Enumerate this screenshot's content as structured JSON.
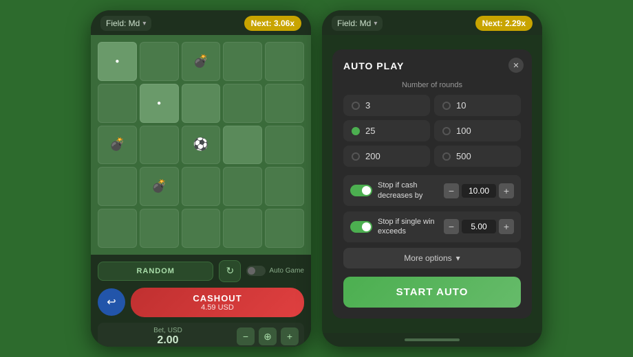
{
  "left_phone": {
    "field_label": "Field: Md",
    "next_label": "Next: 3.06x",
    "grid": [
      [
        "white_dot",
        "empty",
        "bomb",
        "empty",
        "empty"
      ],
      [
        "empty",
        "white_dot",
        "empty",
        "empty",
        "empty"
      ],
      [
        "bomb",
        "empty",
        "soccer",
        "empty",
        "empty"
      ],
      [
        "empty",
        "bomb",
        "empty",
        "empty",
        "empty"
      ],
      [
        "empty",
        "empty",
        "empty",
        "empty",
        "empty"
      ]
    ],
    "random_btn": "RANDOM",
    "auto_game_label": "Auto Game",
    "cashout_label": "CASHOUT",
    "cashout_amount": "4.59 USD",
    "bet_label": "Bet, USD",
    "bet_value": "2.00"
  },
  "right_phone": {
    "field_label": "Field: Md",
    "next_label": "Next: 2.29x",
    "modal": {
      "title": "AUTO PLAY",
      "rounds_label": "Number of rounds",
      "rounds": [
        {
          "value": "3",
          "active": false
        },
        {
          "value": "10",
          "active": false
        },
        {
          "value": "25",
          "active": true
        },
        {
          "value": "100",
          "active": false
        },
        {
          "value": "200",
          "active": false
        },
        {
          "value": "500",
          "active": false
        }
      ],
      "stop_cash_label": "Stop if cash decreases by",
      "stop_cash_value": "10.00",
      "stop_win_label": "Stop if single win exceeds",
      "stop_win_value": "5.00",
      "more_options_label": "More options",
      "start_auto_label": "START AUTO"
    }
  },
  "icons": {
    "bomb": "💣",
    "soccer": "⚽",
    "white_circle": "●",
    "chevron_down": "▾",
    "refresh": "↻",
    "arrow_left": "↩",
    "minus": "−",
    "plus": "+",
    "stack": "⊕",
    "close": "✕",
    "chevron_small": "▾"
  }
}
